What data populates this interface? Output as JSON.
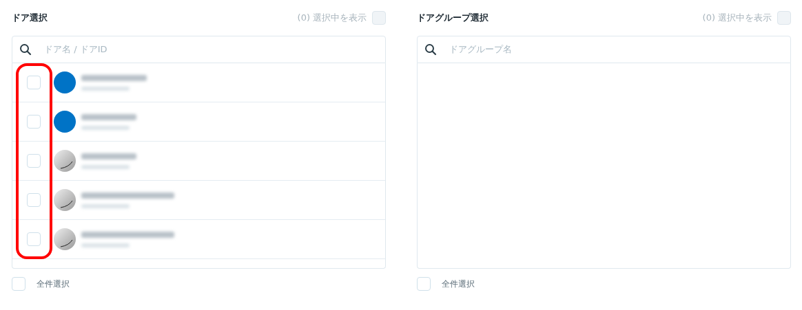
{
  "panels": [
    {
      "title": "ドア選択",
      "selected_count": "(0)",
      "show_selected_label": "選択中を表示",
      "show_selected_checked": false,
      "search": {
        "placeholder": "ドア名 / ドアID"
      },
      "rows": [
        {
          "kind": "dot",
          "color": "#0073c6",
          "checked": false
        },
        {
          "kind": "dot",
          "color": "#0073c6",
          "checked": false
        },
        {
          "kind": "device",
          "checked": false
        },
        {
          "kind": "device",
          "checked": false
        },
        {
          "kind": "device",
          "checked": false
        }
      ],
      "highlight": true,
      "select_all": {
        "label": "全件選択",
        "checked": false
      }
    },
    {
      "title": "ドアグループ選択",
      "selected_count": "(0)",
      "show_selected_label": "選択中を表示",
      "show_selected_checked": false,
      "search": {
        "placeholder": "ドアグループ名"
      },
      "select_all": {
        "label": "全件選択",
        "checked": false
      }
    }
  ]
}
